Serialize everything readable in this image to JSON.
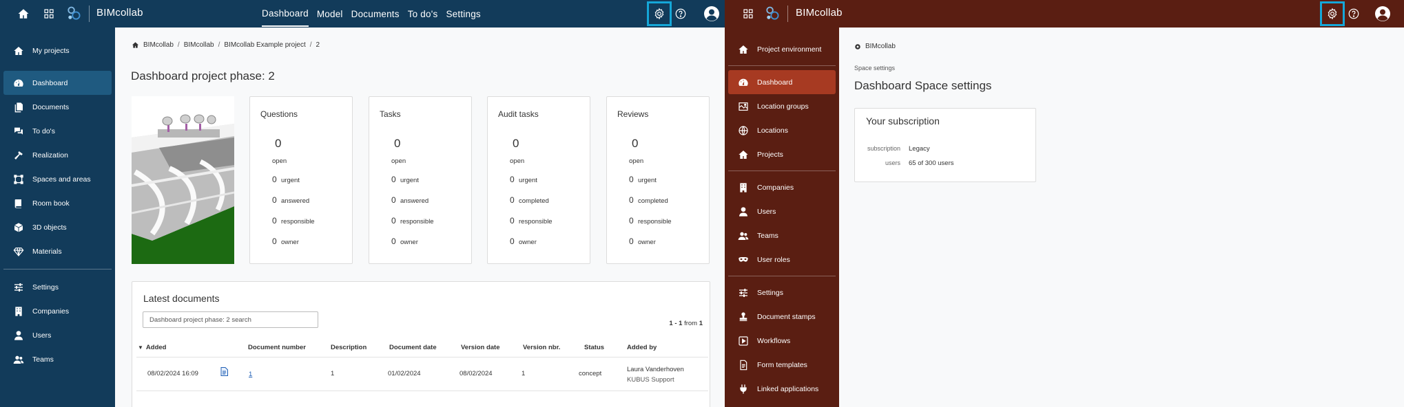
{
  "left": {
    "brand": "BIMcollab",
    "nav": [
      "Dashboard",
      "Model",
      "Documents",
      "To do's",
      "Settings"
    ],
    "nav_active": "Dashboard",
    "sidebar": [
      {
        "label": "My projects",
        "icon": "home-icon"
      },
      {
        "label": "Dashboard",
        "icon": "dashboard-gauge-icon",
        "active": true
      },
      {
        "label": "Documents",
        "icon": "documents-icon"
      },
      {
        "label": "To do's",
        "icon": "comments-icon"
      },
      {
        "label": "Realization",
        "icon": "hammer-icon"
      },
      {
        "label": "Spaces and areas",
        "icon": "spaces-icon"
      },
      {
        "label": "Room book",
        "icon": "book-icon"
      },
      {
        "label": "3D objects",
        "icon": "cube-icon"
      },
      {
        "label": "Materials",
        "icon": "diamond-icon"
      },
      {
        "label": "Settings",
        "icon": "sliders-icon"
      },
      {
        "label": "Companies",
        "icon": "building-icon"
      },
      {
        "label": "Users",
        "icon": "user-icon"
      },
      {
        "label": "Teams",
        "icon": "users-icon"
      }
    ],
    "breadcrumb": [
      "BIMcollab",
      "BIMcollab",
      "BIMcollab Example project",
      "2"
    ],
    "page_title": "Dashboard project phase: 2",
    "cards": [
      {
        "title": "Questions",
        "value": "0",
        "open_label": "open",
        "rows": [
          {
            "n": "0",
            "label": "urgent"
          },
          {
            "n": "0",
            "label": "answered"
          },
          {
            "n": "0",
            "label": "responsible"
          },
          {
            "n": "0",
            "label": "owner"
          }
        ]
      },
      {
        "title": "Tasks",
        "value": "0",
        "open_label": "open",
        "rows": [
          {
            "n": "0",
            "label": "urgent"
          },
          {
            "n": "0",
            "label": "answered"
          },
          {
            "n": "0",
            "label": "responsible"
          },
          {
            "n": "0",
            "label": "owner"
          }
        ]
      },
      {
        "title": "Audit tasks",
        "value": "0",
        "open_label": "open",
        "rows": [
          {
            "n": "0",
            "label": "urgent"
          },
          {
            "n": "0",
            "label": "completed"
          },
          {
            "n": "0",
            "label": "responsible"
          },
          {
            "n": "0",
            "label": "owner"
          }
        ]
      },
      {
        "title": "Reviews",
        "value": "0",
        "open_label": "open",
        "rows": [
          {
            "n": "0",
            "label": "urgent"
          },
          {
            "n": "0",
            "label": "completed"
          },
          {
            "n": "0",
            "label": "responsible"
          },
          {
            "n": "0",
            "label": "owner"
          }
        ]
      }
    ],
    "docs": {
      "title": "Latest documents",
      "search_placeholder": "Dashboard project phase: 2 search",
      "pager_range": "1 - 1",
      "pager_from": "from",
      "pager_total": "1",
      "columns": [
        "Added",
        "Document number",
        "Description",
        "Document date",
        "Version date",
        "Version nbr.",
        "Status",
        "Added by"
      ],
      "row": {
        "added": "08/02/2024 16:09",
        "doc_number": "1",
        "description": "1",
        "doc_date": "01/02/2024",
        "version_date": "08/02/2024",
        "version_nbr": "1",
        "status": "concept",
        "added_by": "Laura Vanderhoven",
        "added_by_company": "KUBUS Support"
      }
    },
    "color_topbar": "#123b5a",
    "color_active": "#1f5a80"
  },
  "right": {
    "brand": "BIMcollab",
    "sidebar_top": [
      {
        "label": "Project environment",
        "icon": "home-icon"
      }
    ],
    "sidebar_group1": [
      {
        "label": "Dashboard",
        "icon": "dashboard-gauge-icon",
        "active": true
      },
      {
        "label": "Location groups",
        "icon": "map-icon"
      },
      {
        "label": "Locations",
        "icon": "globe-icon"
      },
      {
        "label": "Projects",
        "icon": "home-icon"
      }
    ],
    "sidebar_group2": [
      {
        "label": "Companies",
        "icon": "building-icon"
      },
      {
        "label": "Users",
        "icon": "user-icon"
      },
      {
        "label": "Teams",
        "icon": "users-icon"
      },
      {
        "label": "User roles",
        "icon": "mask-icon"
      }
    ],
    "sidebar_group3": [
      {
        "label": "Settings",
        "icon": "sliders-icon"
      },
      {
        "label": "Document stamps",
        "icon": "stamp-icon"
      },
      {
        "label": "Workflows",
        "icon": "play-square-icon"
      },
      {
        "label": "Form templates",
        "icon": "form-icon"
      },
      {
        "label": "Linked applications",
        "icon": "plug-icon"
      }
    ],
    "breadcrumb": "BIMcollab",
    "subtitle": "Space settings",
    "page_title": "Dashboard Space settings",
    "subscription": {
      "title": "Your subscription",
      "subscription_key": "subscription",
      "subscription_value": "Legacy",
      "users_key": "users",
      "users_value": "65 of 300 users"
    },
    "color_topbar": "#5a1e12",
    "color_active": "#a73a22"
  },
  "highlight_color": "#15a7d8"
}
